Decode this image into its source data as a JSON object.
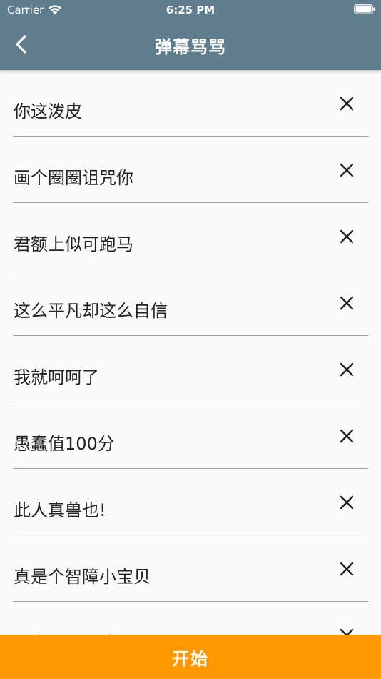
{
  "status_bar": {
    "carrier": "Carrier",
    "time": "6:25 PM",
    "wifi_icon": "wifi-icon",
    "battery_icon": "battery-icon"
  },
  "nav": {
    "title": "弹幕骂骂",
    "back_icon": "chevron-left-icon"
  },
  "list": {
    "delete_icon": "close-icon",
    "items": [
      {
        "text": "你这泼皮"
      },
      {
        "text": "画个圈圈诅咒你"
      },
      {
        "text": "君额上似可跑马"
      },
      {
        "text": "这么平凡却这么自信"
      },
      {
        "text": "我就呵呵了"
      },
      {
        "text": "愚蠢值100分"
      },
      {
        "text": "此人真兽也!"
      },
      {
        "text": "真是个智障小宝贝"
      },
      {
        "text": "要点不可语达"
      }
    ]
  },
  "start_button": {
    "label": "开始"
  },
  "colors": {
    "app_bar": "#5f7d8c",
    "background": "#fafafa",
    "divider": "#9e9e9e",
    "accent": "#ff9800",
    "text": "#222222"
  }
}
